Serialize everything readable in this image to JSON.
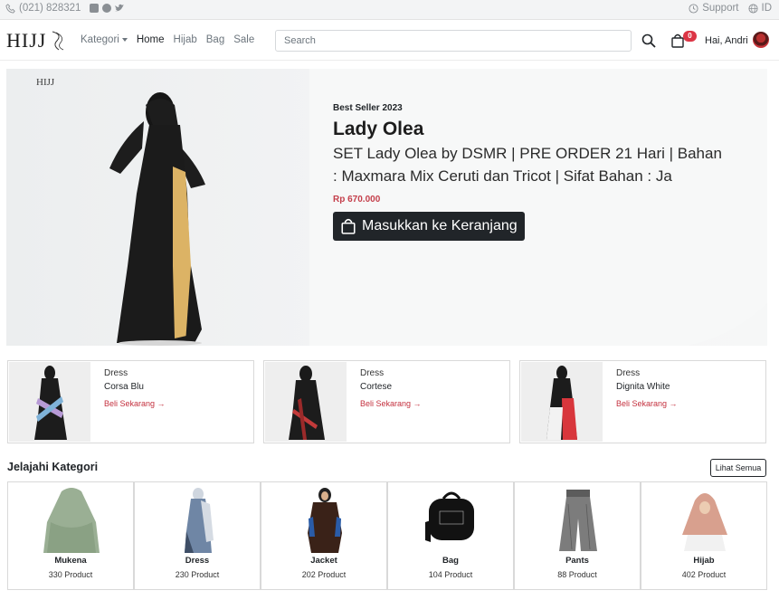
{
  "topbar": {
    "phone": "(021) 828321",
    "support": "Support",
    "language": "ID",
    "social_icons": [
      "instagram-icon",
      "facebook-icon",
      "twitter-icon"
    ]
  },
  "navbar": {
    "logo": "HIJJ",
    "links": {
      "kategori": "Kategori",
      "home": "Home",
      "hijab": "Hijab",
      "bag": "Bag",
      "sale": "Sale"
    },
    "search_placeholder": "Search",
    "cart_count": "0",
    "greeting": "Hai, Andri"
  },
  "hero": {
    "logo": "HIJJ",
    "eyebrow": "Best Seller 2023",
    "title": "Lady Olea",
    "description": "SET Lady Olea by DSMR | PRE ORDER 21 Hari | Bahan : Maxmara Mix Ceruti dan Tricot | Sifat Bahan : Ja",
    "price": "Rp 670.000",
    "button_label": "Masukkan ke Keranjang"
  },
  "products": [
    {
      "category": "Dress",
      "name": "Corsa Blu",
      "link": "Beli Sekarang →"
    },
    {
      "category": "Dress",
      "name": "Cortese",
      "link": "Beli Sekarang →"
    },
    {
      "category": "Dress",
      "name": "Dignita White",
      "link": "Beli Sekarang →"
    }
  ],
  "categories_section": {
    "title": "Jelajahi Kategori",
    "see_all": "Lihat Semua",
    "items": [
      {
        "name": "Mukena",
        "count": "330 Product"
      },
      {
        "name": "Dress",
        "count": "230 Product"
      },
      {
        "name": "Jacket",
        "count": "202 Product"
      },
      {
        "name": "Bag",
        "count": "104 Product"
      },
      {
        "name": "Pants",
        "count": "88 Product"
      },
      {
        "name": "Hijab",
        "count": "402 Product"
      }
    ]
  },
  "colors": {
    "accent_red": "#c4313f",
    "dark": "#212529",
    "badge": "#dc3545"
  }
}
